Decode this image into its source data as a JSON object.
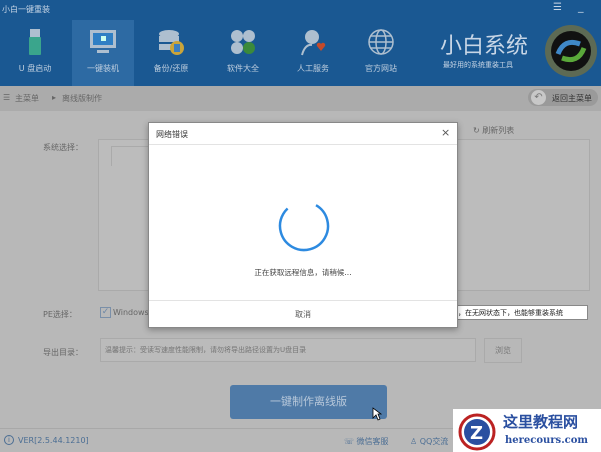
{
  "app": {
    "title": "小白一键重装"
  },
  "nav": {
    "items": [
      {
        "label": "U 盘启动"
      },
      {
        "label": "一键装机"
      },
      {
        "label": "备份/还原"
      },
      {
        "label": "软件大全"
      },
      {
        "label": "人工服务"
      },
      {
        "label": "官方网站"
      }
    ],
    "brand": "小白系统",
    "slogan": "最好用的系统重装工具"
  },
  "breadcrumb": {
    "root": "主菜单",
    "current": "离线版制作",
    "back": "返回主菜单"
  },
  "content": {
    "system_label": "系统选择：",
    "refresh": "刷新列表",
    "pe_label": "PE选择：",
    "pe_option": "Windows",
    "pe_tip": "，在无网状态下，也能够重装系统",
    "export_label": "导出目录：",
    "export_placeholder": "温馨提示：受读写速度性能限制，请勿将导出路径设置为U盘目录",
    "browse": "浏览",
    "make_button": "一键制作离线版"
  },
  "dialog": {
    "title": "网络错误",
    "message": "正在获取远程信息，请稍候...",
    "cancel": "取消"
  },
  "footer": {
    "version": "VER[2.5.44.1210]",
    "wechat": "微信客服",
    "qq": "QQ交流"
  },
  "watermark": {
    "title": "这里教程网",
    "url": "herecours.com"
  }
}
